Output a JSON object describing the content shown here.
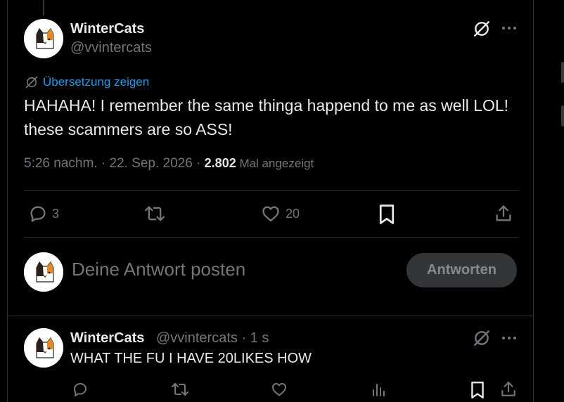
{
  "main_tweet": {
    "display_name": "WinterCats",
    "handle": "@vvintercats",
    "translate_label": "Übersetzung zeigen",
    "text": "HAHAHA! I remember the same thinga happend to me as well LOL! these scammers are so ASS!",
    "time_date": "5:26 nachm. · 22. Sep. 2026 · ",
    "views_count": "2.802",
    "views_label": " Mal angezeigt",
    "replies_count": "3",
    "likes_count": "20"
  },
  "composer": {
    "placeholder": "Deine Antwort posten",
    "button_label": "Antworten"
  },
  "reply_tweet": {
    "display_name": "WinterCats",
    "handle_time": "@vvintercats · 1 s",
    "text": "WHAT THE FU I HAVE 20LIKES HOW"
  },
  "colors": {
    "background": "#000000",
    "text": "#e7e9ea",
    "muted": "#71767b",
    "link": "#1d9bf0",
    "divider": "#2f3336",
    "button_bg": "#333639"
  },
  "icons": {
    "grok": "grok-icon",
    "more": "more-icon",
    "translate": "translate-icon",
    "reply": "reply-icon",
    "repost": "repost-icon",
    "like": "like-icon",
    "bookmark": "bookmark-icon",
    "share": "share-icon",
    "views": "views-icon"
  }
}
